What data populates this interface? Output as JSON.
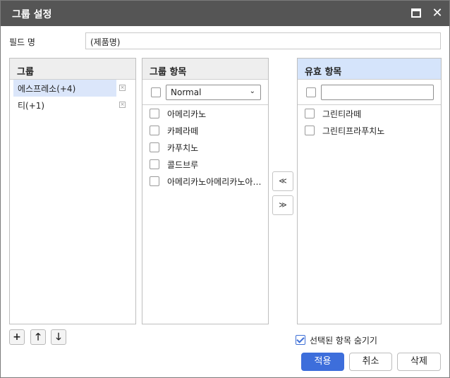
{
  "dialog": {
    "title": "그룹 설정",
    "maximize_icon": "maximize-icon",
    "close_icon": "close-icon",
    "close_glyph": "✕"
  },
  "field": {
    "label": "필드 명",
    "value": "(제품명)"
  },
  "groups_panel": {
    "header": "그룹",
    "items": [
      {
        "label": "에스프레소(+4)",
        "selected": true
      },
      {
        "label": "티(+1)",
        "selected": false
      }
    ],
    "delete_glyph": "×"
  },
  "group_items_panel": {
    "header": "그룹 항목",
    "select_value": "Normal",
    "chevron": "⌄",
    "items": [
      {
        "label": "아메리카노"
      },
      {
        "label": "카페라떼"
      },
      {
        "label": "카푸치노"
      },
      {
        "label": "콜드브루"
      },
      {
        "label": "아메리카노아메리카노아메리카노"
      }
    ]
  },
  "valid_items_panel": {
    "header": "유효 항목",
    "filter_value": "",
    "items": [
      {
        "label": "그린티라떼"
      },
      {
        "label": "그린티프라푸치노"
      }
    ]
  },
  "move": {
    "to_group_glyph": "≪",
    "to_valid_glyph": "≫"
  },
  "toolbar": {
    "add_glyph": "+",
    "up_glyph": "🡑",
    "down_glyph": "🡓"
  },
  "hide_selected": {
    "label": "선택된 항목 숨기기",
    "checked": true
  },
  "buttons": {
    "apply": "적용",
    "cancel": "취소",
    "delete": "삭제"
  },
  "colors": {
    "titlebar": "#555555",
    "accent": "#3d6edb",
    "selection": "#dbe6fa",
    "valid_header": "#d5e4fb"
  }
}
